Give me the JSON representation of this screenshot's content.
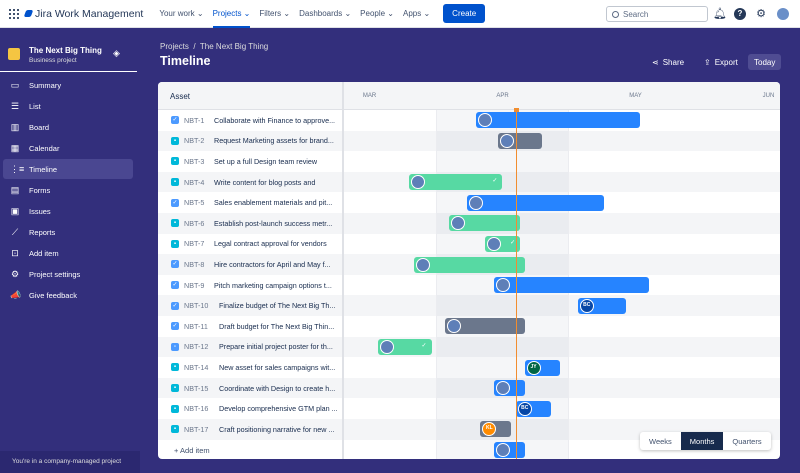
{
  "topnav": {
    "logo": "Jira Work Management",
    "items": [
      "Your work ⌄",
      "Projects ⌄",
      "Filters ⌄",
      "Dashboards ⌄",
      "People ⌄",
      "Apps ⌄"
    ],
    "active": 1,
    "create": "Create",
    "search_placeholder": "Search"
  },
  "sidebar": {
    "project_name": "The Next Big Thing",
    "project_type": "Business project",
    "items": [
      {
        "label": "Summary",
        "icon": "▭"
      },
      {
        "label": "List",
        "icon": "☰"
      },
      {
        "label": "Board",
        "icon": "▥"
      },
      {
        "label": "Calendar",
        "icon": "▦"
      },
      {
        "label": "Timeline",
        "icon": "⋮≡",
        "active": true
      },
      {
        "label": "Forms",
        "icon": "▤"
      },
      {
        "label": "Issues",
        "icon": "▣"
      },
      {
        "label": "Reports",
        "icon": "⟋"
      },
      {
        "label": "Add item",
        "icon": "⊡"
      },
      {
        "label": "Project settings",
        "icon": "⚙"
      },
      {
        "label": "Give feedback",
        "icon": "📣"
      }
    ],
    "footer": "You're in a company-managed project"
  },
  "header": {
    "breadcrumb_root": "Projects",
    "breadcrumb_sep": "/",
    "breadcrumb_project": "The Next Big Thing",
    "title": "Timeline",
    "share": "Share",
    "export": "Export",
    "today": "Today"
  },
  "timeline": {
    "column_header": "Asset",
    "months": [
      "MAR",
      "APR",
      "MAY",
      "JUN"
    ],
    "today": "04-19",
    "add_item": "Add item",
    "colors": {
      "blue": "#2684ff",
      "grey": "#6b778c",
      "green": "#57d9a3"
    },
    "rows": [
      {
        "key": "NBT-1",
        "summary": "Collaborate with Finance to approve...",
        "type": "task",
        "start": "04-10",
        "end": "05-17",
        "color": "blue",
        "avatar": "photo"
      },
      {
        "key": "NBT-2",
        "summary": "Request Marketing assets for brand...",
        "type": "story",
        "start": "04-15",
        "end": "04-25",
        "color": "grey",
        "avatar": "photo"
      },
      {
        "key": "NBT-3",
        "summary": "Set up a full Design team review",
        "type": "story"
      },
      {
        "key": "NBT-4",
        "summary": "Write content for blog posts and",
        "type": "story",
        "start": "03-26",
        "end": "04-16",
        "color": "green",
        "avatar": "photo",
        "done": true
      },
      {
        "key": "NBT-5",
        "summary": "Sales enablement materials and pit...",
        "type": "task",
        "start": "04-08",
        "end": "05-09",
        "color": "blue",
        "avatar": "photo"
      },
      {
        "key": "NBT-6",
        "summary": "Establish post-launch success metr...",
        "type": "story",
        "start": "04-04",
        "end": "04-20",
        "color": "green",
        "avatar": "photo"
      },
      {
        "key": "NBT-7",
        "summary": "Legal contract approval for vendors",
        "type": "story",
        "start": "04-12",
        "end": "04-20",
        "color": "green",
        "avatar": "photo",
        "done": true
      },
      {
        "key": "NBT-8",
        "summary": "Hire contractors for April and May f...",
        "type": "task",
        "start": "03-27",
        "end": "04-21",
        "color": "green",
        "avatar": "photo"
      },
      {
        "key": "NBT-9",
        "summary": "Pitch marketing campaign options t...",
        "type": "task",
        "start": "04-14",
        "end": "05-19",
        "color": "blue",
        "avatar": "photo"
      },
      {
        "key": "NBT-10",
        "summary": "Finalize budget of The Next Big Th...",
        "type": "task",
        "start": "05-03",
        "end": "05-14",
        "color": "blue",
        "avatar": "BC"
      },
      {
        "key": "NBT-11",
        "summary": "Draft budget for The Next Big Thin...",
        "type": "task",
        "start": "04-03",
        "end": "04-21",
        "color": "grey",
        "avatar": "photo"
      },
      {
        "key": "NBT-12",
        "summary": "Prepare initial project poster for th...",
        "type": "subtask",
        "start": "03-19",
        "end": "03-31",
        "color": "green",
        "avatar": "photo",
        "done": true
      },
      {
        "key": "NBT-14",
        "summary": "New asset for sales campaigns wit...",
        "type": "story",
        "start": "04-21",
        "end": "04-29",
        "color": "blue",
        "avatar": "JY"
      },
      {
        "key": "NBT-15",
        "summary": "Coordinate with Design to create h...",
        "type": "story",
        "start": "04-14",
        "end": "04-21",
        "color": "blue",
        "avatar": "photo"
      },
      {
        "key": "NBT-16",
        "summary": "Develop comprehensive GTM plan ...",
        "type": "story",
        "start": "04-19",
        "end": "04-27",
        "color": "blue",
        "avatar": "BC"
      },
      {
        "key": "NBT-17",
        "summary": "Craft positioning narrative for new ...",
        "type": "story",
        "start": "04-11",
        "end": "04-18",
        "color": "grey",
        "avatar": "KL"
      }
    ],
    "add_row_bar": {
      "start": "04-14",
      "end": "04-21",
      "color": "blue",
      "avatar": "photo"
    },
    "scale": {
      "options": [
        "Weeks",
        "Months",
        "Quarters"
      ],
      "selected": "Months"
    }
  }
}
